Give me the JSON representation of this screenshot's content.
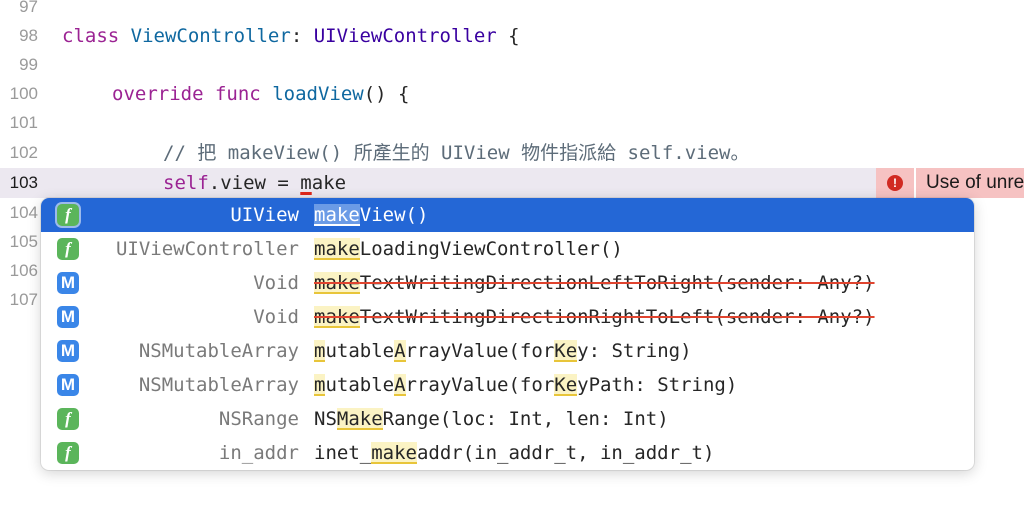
{
  "editor": {
    "lines": [
      {
        "number": "97"
      },
      {
        "number": "98",
        "tokens": {
          "kw": "class",
          "name": "ViewController",
          "sep": ": ",
          "parent": "UIViewController",
          "tail": " {"
        }
      },
      {
        "number": "99"
      },
      {
        "number": "100",
        "tokens": {
          "kw1": "override",
          "kw2": "func",
          "name": "loadView",
          "tail": "() {"
        }
      },
      {
        "number": "101"
      },
      {
        "number": "102",
        "tokens": {
          "comment": "// 把 makeView() 所產生的 UIView 物件指派給 self.view。"
        }
      },
      {
        "number": "103",
        "tokens": {
          "kw": "self",
          "mid": ".view = ",
          "err_char": "m",
          "rest": "ake"
        }
      },
      {
        "number": "104"
      },
      {
        "number": "105"
      },
      {
        "number": "106"
      },
      {
        "number": "107"
      }
    ],
    "current_line": "103"
  },
  "error": {
    "icon": "exclamation-icon",
    "message": "Use of unresolved identifier 'make'",
    "color": "#d12a22"
  },
  "completion": {
    "items": [
      {
        "kind": "f",
        "return_type": "UIView",
        "pre": "",
        "match": "make",
        "post": "View()",
        "deprecated": false,
        "selected": true
      },
      {
        "kind": "f",
        "return_type": "UIViewController",
        "pre": "",
        "match": "make",
        "post": "LoadingViewController()",
        "deprecated": false
      },
      {
        "kind": "M",
        "return_type": "Void",
        "pre": "",
        "match": "make",
        "post": "TextWritingDirectionLeftToRight(sender: Any?)",
        "deprecated": true
      },
      {
        "kind": "M",
        "return_type": "Void",
        "pre": "",
        "match": "make",
        "post": "TextWritingDirectionRightToLeft(sender: Any?)",
        "deprecated": true
      },
      {
        "kind": "M",
        "return_type": "NSMutableArray",
        "segments": [
          [
            "m",
            true
          ],
          [
            "utable",
            false
          ],
          [
            "A",
            true
          ],
          [
            "rrayValue(for",
            false
          ],
          [
            "Ke",
            true
          ],
          [
            "y: String)",
            false
          ]
        ],
        "deprecated": false
      },
      {
        "kind": "M",
        "return_type": "NSMutableArray",
        "segments": [
          [
            "m",
            true
          ],
          [
            "utable",
            false
          ],
          [
            "A",
            true
          ],
          [
            "rrayValue(for",
            false
          ],
          [
            "Ke",
            true
          ],
          [
            "yPath: String)",
            false
          ]
        ],
        "deprecated": false
      },
      {
        "kind": "f",
        "return_type": "NSRange",
        "pre": "NS",
        "match": "Make",
        "post": "Range(loc: Int, len: Int)",
        "deprecated": false
      },
      {
        "kind": "f",
        "return_type": "in_addr",
        "pre": "inet_",
        "match": "make",
        "post": "addr(in_addr_t, in_addr_t)",
        "deprecated": false
      }
    ],
    "badge_labels": {
      "f": "f",
      "M": "M"
    },
    "colors": {
      "selected": "#2467d6",
      "function_badge": "#5bb55b",
      "method_badge": "#3a86e8",
      "match_highlight": "#fbf3c4"
    }
  }
}
